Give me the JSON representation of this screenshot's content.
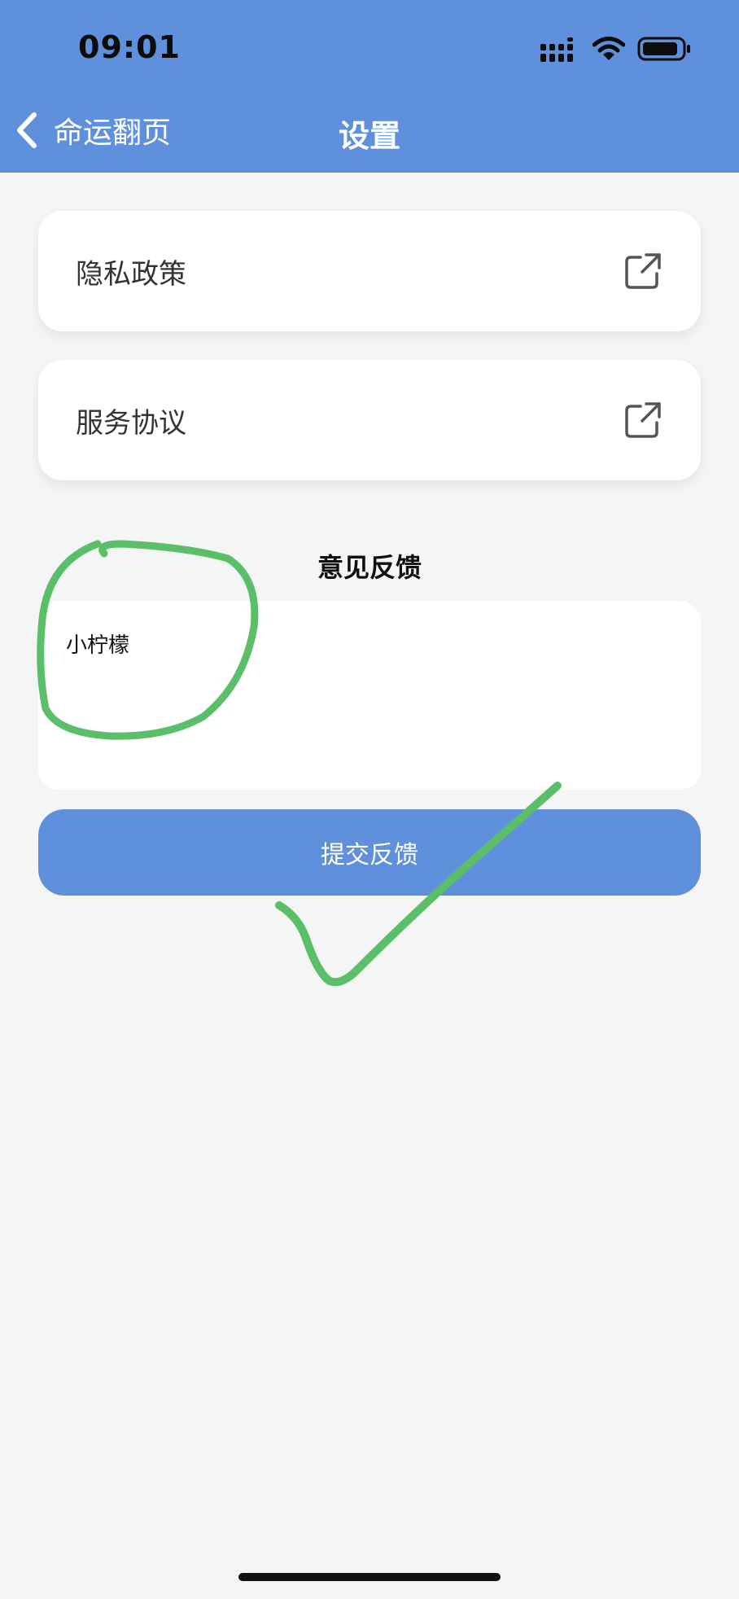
{
  "status_bar": {
    "time": "09:01",
    "icons": [
      "signal-icon",
      "wifi-icon",
      "battery-icon"
    ]
  },
  "nav": {
    "back_icon": "chevron-left-icon",
    "back_label": "命运翻页",
    "title": "设置"
  },
  "menu": [
    {
      "label": "隐私政策",
      "icon": "external-link-icon"
    },
    {
      "label": "服务协议",
      "icon": "external-link-icon"
    }
  ],
  "feedback": {
    "title": "意见反馈",
    "input_value": "小柠檬",
    "submit_label": "提交反馈"
  },
  "colors": {
    "accent": "#5f90dc",
    "background": "#f4f5f5",
    "annotation": "#5bbf6a"
  },
  "annotations": [
    "green circle around feedback text",
    "green check mark over submit button"
  ]
}
